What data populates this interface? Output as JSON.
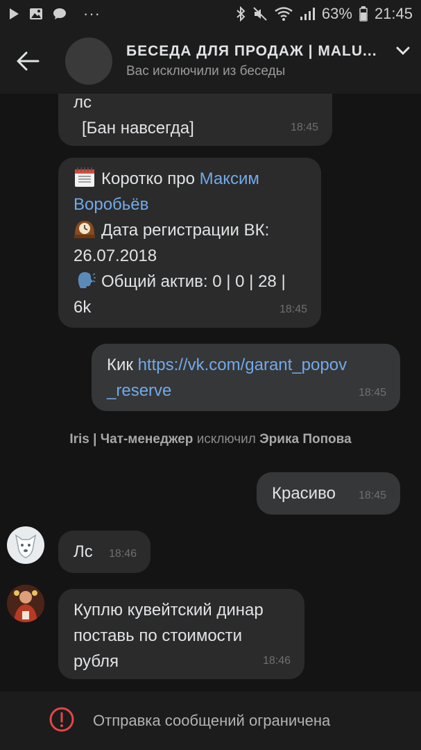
{
  "status_bar": {
    "battery": "63%",
    "time": "21:45",
    "overflow": "···"
  },
  "header": {
    "title": "БЕСЕДА ДЛЯ ПРОДАЖ | MALU...",
    "subtitle": "Вас исключили из беседы"
  },
  "messages": {
    "m1": {
      "line1": "лс",
      "line2": "[Бан навсегда]",
      "time": "18:45"
    },
    "m2": {
      "prefix": "Коротко про",
      "name_part1": "Максим",
      "name_part2": "Воробьёв",
      "reg_label": "Дата регистрации ВК:",
      "reg_date": "26.07.2018",
      "activity_label": "Общий актив: 0 | 0 | 28 |",
      "activity_tail": "6k",
      "time": "18:45"
    },
    "m3": {
      "prefix": "Кик",
      "link_part1": "https://vk.com/garant_popov",
      "link_part2": "_reserve",
      "time": "18:45"
    },
    "system": {
      "actor": "Iris",
      "sep": "|",
      "role": "Чат-менеджер",
      "action": "исключил",
      "target": "Эрика Попова"
    },
    "m4": {
      "text": "Красиво",
      "time": "18:45"
    },
    "m5": {
      "text": "Лс",
      "time": "18:46"
    },
    "m6": {
      "line1": "Куплю кувейтский динар",
      "line2": "поставь по стоимости",
      "line3": "рубля",
      "time": "18:46"
    }
  },
  "bottom": {
    "text": "Отправка сообщений ограничена"
  },
  "colors": {
    "background": "#141414",
    "bubble": "#2b2b2b",
    "link": "#71aaeb",
    "error": "#e64646"
  }
}
